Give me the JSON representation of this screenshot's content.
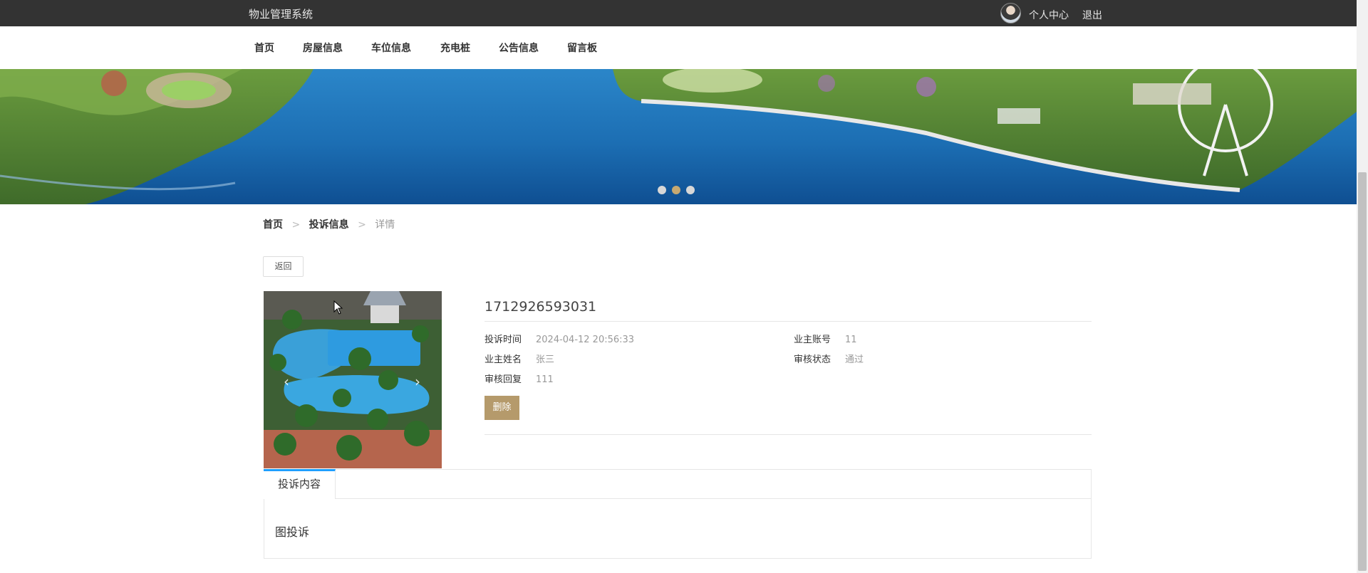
{
  "header": {
    "app_title": "物业管理系统",
    "profile_link": "个人中心",
    "logout_link": "退出"
  },
  "nav": {
    "items": [
      "首页",
      "房屋信息",
      "车位信息",
      "充电桩",
      "公告信息",
      "留言板"
    ]
  },
  "carousel": {
    "slide_count": 3,
    "active_index": 1
  },
  "breadcrumb": {
    "home": "首页",
    "section": "投诉信息",
    "current": "详情",
    "separator": ">"
  },
  "actions": {
    "back_label": "返回",
    "delete_label": "删除"
  },
  "detail": {
    "title": "1712926593031",
    "fields": {
      "complaint_time_label": "投诉时间",
      "complaint_time_value": "2024-04-12 20:56:33",
      "owner_account_label": "业主账号",
      "owner_account_value": "11",
      "owner_name_label": "业主姓名",
      "owner_name_value": "张三",
      "review_status_label": "审核状态",
      "review_status_value": "通过",
      "review_reply_label": "审核回复",
      "review_reply_value": "111"
    }
  },
  "tabs": {
    "active_label": "投诉内容",
    "content": "图投诉"
  },
  "colors": {
    "topbar": "#333333",
    "accent": "#b59a6b",
    "tab_highlight": "#1e9fff",
    "active_dot": "#c7a971"
  }
}
